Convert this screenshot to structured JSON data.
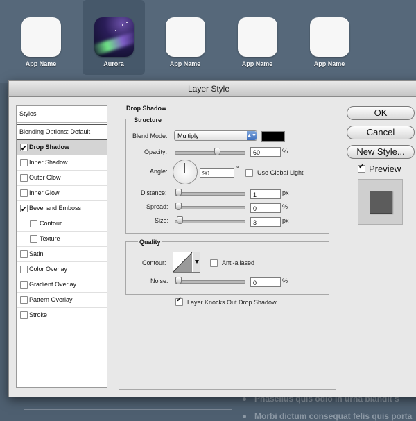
{
  "apps": [
    {
      "name": "App Name",
      "icon": "blank-app-icon"
    },
    {
      "name": "Aurora",
      "icon": "aurora-app-icon",
      "selected": true
    },
    {
      "name": "App Name",
      "icon": "blank-app-icon"
    },
    {
      "name": "App Name",
      "icon": "blank-app-icon"
    },
    {
      "name": "App Name",
      "icon": "blank-app-icon"
    }
  ],
  "background": {
    "bullet1": "Phasellus quis odio in urna blandit s",
    "bullet2": "Morbi dictum consequat felis quis porta"
  },
  "dialog": {
    "title": "Layer Style",
    "styles_header": "Styles",
    "blending_options": "Blending Options: Default",
    "effects": [
      {
        "label": "Drop Shadow",
        "checked": true,
        "active": true
      },
      {
        "label": "Inner Shadow",
        "checked": false
      },
      {
        "label": "Outer Glow",
        "checked": false
      },
      {
        "label": "Inner Glow",
        "checked": false
      },
      {
        "label": "Bevel and Emboss",
        "checked": true
      },
      {
        "label": "Contour",
        "checked": false,
        "sub": true
      },
      {
        "label": "Texture",
        "checked": false,
        "sub": true
      },
      {
        "label": "Satin",
        "checked": false
      },
      {
        "label": "Color Overlay",
        "checked": false
      },
      {
        "label": "Gradient Overlay",
        "checked": false
      },
      {
        "label": "Pattern Overlay",
        "checked": false
      },
      {
        "label": "Stroke",
        "checked": false
      }
    ],
    "panel_title": "Drop Shadow",
    "structure": {
      "title": "Structure",
      "blend_mode_label": "Blend Mode:",
      "blend_mode_value": "Multiply",
      "shadow_color": "#000000",
      "opacity_label": "Opacity:",
      "opacity_value": "60",
      "opacity_unit": "%",
      "angle_label": "Angle:",
      "angle_value": "90",
      "angle_unit": "°",
      "use_global_light": "Use Global Light",
      "distance_label": "Distance:",
      "distance_value": "1",
      "distance_unit": "px",
      "spread_label": "Spread:",
      "spread_value": "0",
      "spread_unit": "%",
      "size_label": "Size:",
      "size_value": "3",
      "size_unit": "px"
    },
    "quality": {
      "title": "Quality",
      "contour_label": "Contour:",
      "anti_aliased": "Anti-aliased",
      "noise_label": "Noise:",
      "noise_value": "0",
      "noise_unit": "%"
    },
    "knockout_label": "Layer Knocks Out Drop Shadow",
    "buttons": {
      "ok": "OK",
      "cancel": "Cancel",
      "new_style": "New Style...",
      "preview": "Preview"
    }
  }
}
